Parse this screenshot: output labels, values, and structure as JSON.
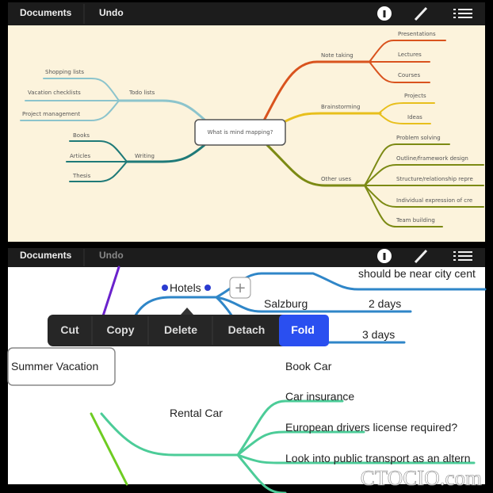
{
  "top": {
    "toolbar": {
      "documents": "Documents",
      "undo": "Undo",
      "icons": [
        "info-icon",
        "wrench-icon",
        "list-icon"
      ]
    },
    "central": "What is mind mapping?",
    "branches": {
      "note_taking": {
        "label": "Note taking",
        "color": "#d9531e",
        "children": [
          "Presentations",
          "Lectures",
          "Courses"
        ]
      },
      "brainstorming": {
        "label": "Brainstorming",
        "color": "#e8bf1c",
        "children": [
          "Projects",
          "Ideas"
        ]
      },
      "other_uses": {
        "label": "Other uses",
        "color": "#7c8a14",
        "children": [
          "Problem solving",
          "Outline/framework design",
          "Structure/relationship repre",
          "Individual expression of cre",
          "Team building"
        ]
      },
      "todo_lists": {
        "label": "Todo lists",
        "color": "#8cc4cc",
        "children": [
          "Shopping lists",
          "Vacation checklists",
          "Project management"
        ]
      },
      "writing": {
        "label": "Writing",
        "color": "#1f7a78",
        "children": [
          "Books",
          "Articles",
          "Thesis"
        ]
      }
    },
    "background": "#fcf3dc"
  },
  "bottom": {
    "toolbar": {
      "documents": "Documents",
      "undo": "Undo",
      "icons": [
        "info-icon",
        "wrench-icon",
        "list-icon"
      ]
    },
    "central": "Summer Vacation",
    "hotels": {
      "label": "Hotels",
      "color": "#2f86c8",
      "items": [
        "should be near city cent",
        "Salzburg",
        "2 days",
        "3 days"
      ]
    },
    "rental_car": {
      "label": "Rental Car",
      "color": "#4ccc98",
      "children": [
        "Book Car",
        "Car insurance",
        "European drivers license required?",
        "Look into public transport as an altern"
      ]
    },
    "context_menu": [
      "Cut",
      "Copy",
      "Delete",
      "Detach",
      "Fold"
    ],
    "context_menu_selected": "Fold",
    "accent": "#2a4ff0"
  },
  "watermark": "CTOCIO.com"
}
